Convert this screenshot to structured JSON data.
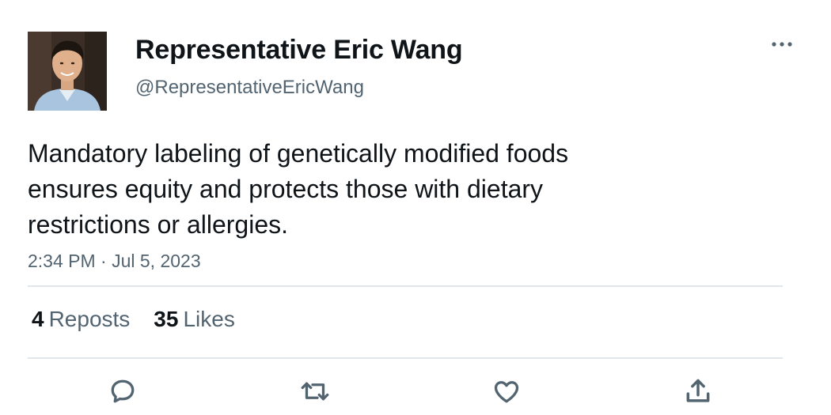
{
  "author": {
    "display_name": "Representative Eric Wang",
    "handle": "@RepresentativeEricWang",
    "avatar_icon": "profile-photo"
  },
  "tweet": {
    "text": "Mandatory labeling of genetically modified foods ensures equity and protects those with dietary restrictions or allergies.",
    "timestamp": "2:34 PM · Jul 5, 2023"
  },
  "stats": {
    "reposts_count": "4",
    "reposts_label": "Reposts",
    "likes_count": "35",
    "likes_label": "Likes"
  },
  "actions": [
    "reply-icon",
    "repost-icon",
    "like-icon",
    "share-icon"
  ],
  "colors": {
    "text_primary": "#0f1419",
    "text_secondary": "#536471",
    "divider": "#e1e6ea",
    "background": "#ffffff"
  }
}
